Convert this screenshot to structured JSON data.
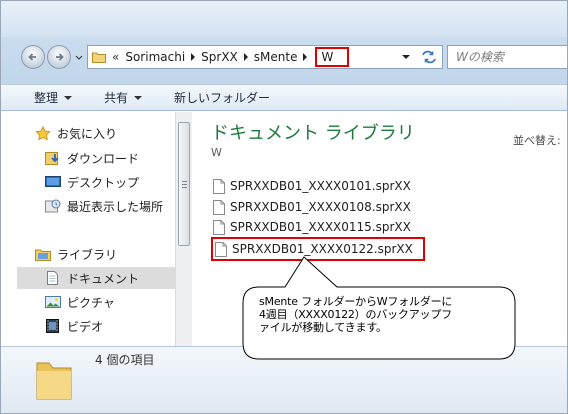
{
  "address": {
    "breadcrumbs": [
      "Sorimachi",
      "SprXX",
      "sMente"
    ],
    "prefix": "«",
    "current": "W"
  },
  "search": {
    "placeholder": "Wの検索"
  },
  "toolbar": {
    "organize": "整理",
    "share": "共有",
    "new_folder": "新しいフォルダー"
  },
  "nav": {
    "favorites": "お気に入り",
    "downloads": "ダウンロード",
    "desktop": "デスクトップ",
    "recent": "最近表示した場所",
    "libraries": "ライブラリ",
    "documents": "ドキュメント",
    "pictures": "ピクチャ",
    "videos": "ビデオ"
  },
  "content": {
    "title": "ドキュメント ライブラリ",
    "subtitle": "W",
    "sort_label": "並べ替え:",
    "files": [
      "SPRXXDB01_XXXX0101.sprXX",
      "SPRXXDB01_XXXX0108.sprXX",
      "SPRXXDB01_XXXX0115.sprXX",
      "SPRXXDB01_XXXX0122.sprXX"
    ]
  },
  "status": {
    "item_count": "4 個の項目"
  },
  "callout": {
    "line1": "sMente フォルダーからWフォルダーに",
    "line2": "4週目（XXXX0122）のバックアップフ",
    "line3": "ァイルが移動してきます。"
  },
  "colors": {
    "highlight": "#e00000",
    "library_title": "#1e7a3c",
    "selected_row": "#dcdcdc"
  }
}
